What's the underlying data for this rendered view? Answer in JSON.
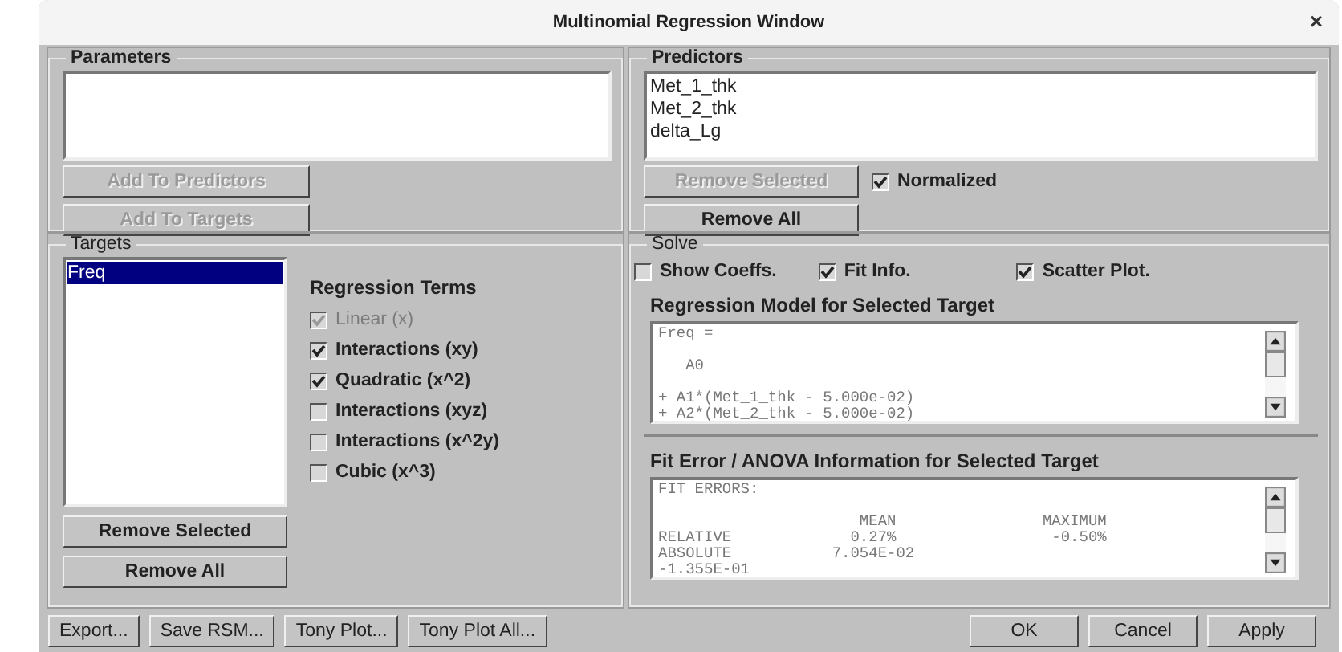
{
  "window": {
    "title": "Multinomial Regression Window",
    "close": "×"
  },
  "parameters": {
    "title": "Parameters",
    "buttons": [
      {
        "label": "Add To Predictors",
        "disabled": true
      },
      {
        "label": "Add To Targets",
        "disabled": true
      }
    ]
  },
  "predictors": {
    "title": "Predictors",
    "items": [
      "Met_1_thk",
      "Met_2_thk",
      "delta_Lg"
    ],
    "buttons": [
      {
        "label": "Remove Selected",
        "disabled": true
      },
      {
        "label": "Remove All",
        "disabled": false
      }
    ],
    "normalized": {
      "label": "Normalized",
      "checked": true,
      "disabled": false
    }
  },
  "targets": {
    "title": "Targets",
    "items": [
      {
        "label": "Freq",
        "selected": true
      }
    ],
    "buttons": [
      {
        "label": "Remove Selected",
        "disabled": false
      },
      {
        "label": "Remove All",
        "disabled": false
      }
    ],
    "terms_title": "Regression Terms",
    "terms": [
      {
        "label": "Linear (x)",
        "checked": true,
        "disabled": true
      },
      {
        "label": "Interactions (xy)",
        "checked": true,
        "disabled": false
      },
      {
        "label": "Quadratic (x^2)",
        "checked": true,
        "disabled": false
      },
      {
        "label": "Interactions (xyz)",
        "checked": false,
        "disabled": false
      },
      {
        "label": "Interactions (x^2y)",
        "checked": false,
        "disabled": false
      },
      {
        "label": "Cubic (x^3)",
        "checked": false,
        "disabled": false
      }
    ]
  },
  "solve": {
    "title": "Solve",
    "options": [
      {
        "label": "Show Coeffs.",
        "checked": false,
        "disabled": false
      },
      {
        "label": "Fit Info.",
        "checked": true,
        "disabled": false
      },
      {
        "label": "Scatter Plot.",
        "checked": true,
        "disabled": false
      }
    ],
    "model_title": "Regression Model for Selected Target",
    "model_text": "Freq =\n\n   A0\n\n+ A1*(Met_1_thk - 5.000e-02)\n+ A2*(Met_2_thk - 5.000e-02)",
    "anova_title": "Fit Error / ANOVA Information for Selected Target",
    "anova_text": "FIT ERRORS:\n\n                      MEAN                MAXIMUM\nRELATIVE             0.27%                 -0.50%\nABSOLUTE           7.054E-02\n-1.355E-01"
  },
  "footer": {
    "left": [
      {
        "label": "Export..."
      },
      {
        "label": "Save RSM..."
      },
      {
        "label": "Tony Plot..."
      },
      {
        "label": "Tony Plot All..."
      }
    ],
    "right": [
      {
        "label": "OK"
      },
      {
        "label": "Cancel"
      },
      {
        "label": "Apply"
      }
    ]
  }
}
